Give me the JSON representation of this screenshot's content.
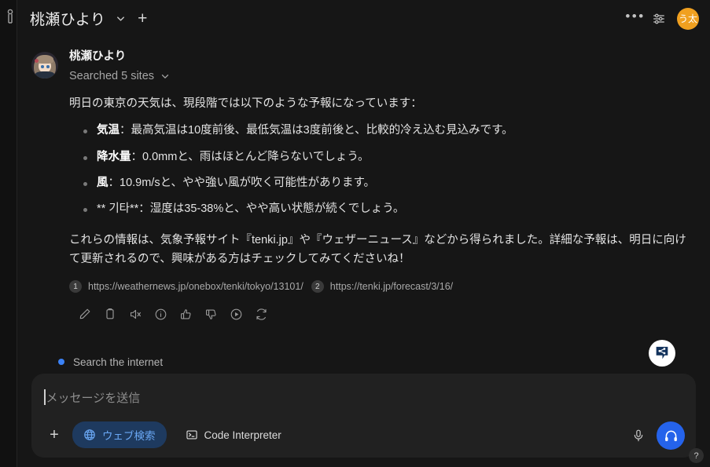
{
  "header": {
    "title": "桃瀬ひより",
    "chevron_icon": "chevron-down-icon",
    "plus_icon": "plus-icon",
    "more_icon": "more-dots-icon",
    "settings_icon": "sliders-icon",
    "avatar_initials": "う太",
    "avatar_color": "#f0a020"
  },
  "rail": {
    "icon": "clipped-tool-icon"
  },
  "message": {
    "sender": "桃瀬ひより",
    "searched_label": "Searched 5 sites",
    "searched_chevron": "chevron-down-icon",
    "intro": "明日の東京の天気は、現段階では以下のような予報になっています：",
    "bullets": [
      {
        "label": "気温",
        "text": "：最高気温は10度前後、最低気温は3度前後と、比較的冷え込む見込みです。"
      },
      {
        "label": "降水量",
        "text": "：0.0mmと、雨はほとんど降らないでしょう。"
      },
      {
        "label": "風",
        "text": "：10.9m/sと、やや強い風が吹く可能性があります。"
      },
      {
        "label": "** 기타**",
        "text": "：湿度は35-38%と、やや高い状態が続くでしょう。"
      }
    ],
    "closing": "これらの情報は、気象予報サイト『tenki.jp』や『ウェザーニュース』などから得られました。詳細な予報は、明日に向けて更新されるので、興味がある方はチェックしてみてくださいね！",
    "citations": [
      {
        "num": "1",
        "url": "https://weathernews.jp/onebox/tenki/tokyo/13101/"
      },
      {
        "num": "2",
        "url": "https://tenki.jp/forecast/3/16/"
      }
    ],
    "actions": [
      "edit-icon",
      "copy-icon",
      "mute-icon",
      "info-icon",
      "thumbs-up-icon",
      "thumbs-down-icon",
      "play-icon",
      "regenerate-icon"
    ]
  },
  "status": {
    "text": "Search the internet",
    "dot_color": "#3b82f6"
  },
  "composer": {
    "placeholder": "メッセージを送信",
    "value": "",
    "plus_icon": "plus-icon",
    "web_search_label": "ウェブ検索",
    "web_search_icon": "globe-icon",
    "code_interpreter_label": "Code Interpreter",
    "code_interpreter_icon": "terminal-icon",
    "mic_icon": "microphone-icon",
    "headset_icon": "headphones-icon",
    "send_icon": "send-badge-icon",
    "accent_color": "#2563eb"
  },
  "help": {
    "label": "?"
  }
}
